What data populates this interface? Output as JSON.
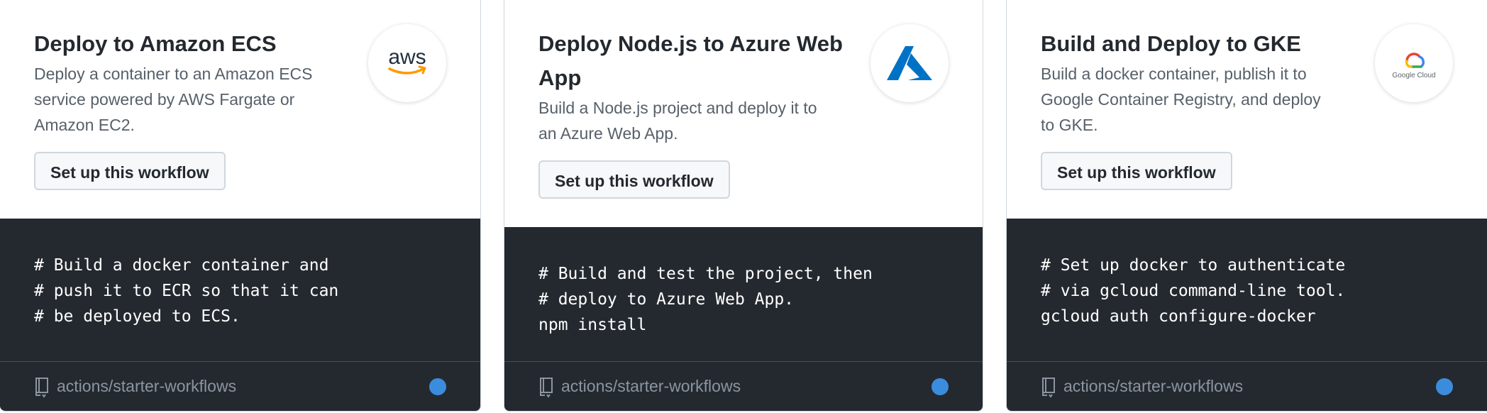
{
  "colors": {
    "code_background": "#24292f",
    "button_background": "#f6f8fa",
    "language_dot": "#3b8cdd",
    "aws_orange": "#ff9900",
    "azure_blue": "#0072c6"
  },
  "cards": [
    {
      "title": "Deploy to Amazon ECS",
      "description": "Deploy a container to an Amazon ECS service powered by AWS Fargate or Amazon EC2.",
      "button_label": "Set up this workflow",
      "logo_icon": "aws-logo-icon",
      "logo_text": "aws",
      "code_lines": [
        "# Build a docker container and",
        "# push it to ECR so that it can",
        "# be deployed to ECS."
      ],
      "repo": "actions/starter-workflows"
    },
    {
      "title": "Deploy Node.js to Azure Web App",
      "description": "Build a Node.js project and deploy it to an Azure Web App.",
      "button_label": "Set up this workflow",
      "logo_icon": "azure-logo-icon",
      "code_lines": [
        "# Build and test the project, then",
        "# deploy to Azure Web App.",
        "npm install"
      ],
      "repo": "actions/starter-workflows"
    },
    {
      "title": "Build and Deploy to GKE",
      "description": "Build a docker container, publish it to Google Container Registry, and deploy to GKE.",
      "button_label": "Set up this workflow",
      "logo_icon": "google-cloud-logo-icon",
      "logo_text": "Google Cloud",
      "code_lines": [
        "# Set up docker to authenticate",
        "# via gcloud command-line tool.",
        "gcloud auth configure-docker"
      ],
      "repo": "actions/starter-workflows"
    }
  ]
}
